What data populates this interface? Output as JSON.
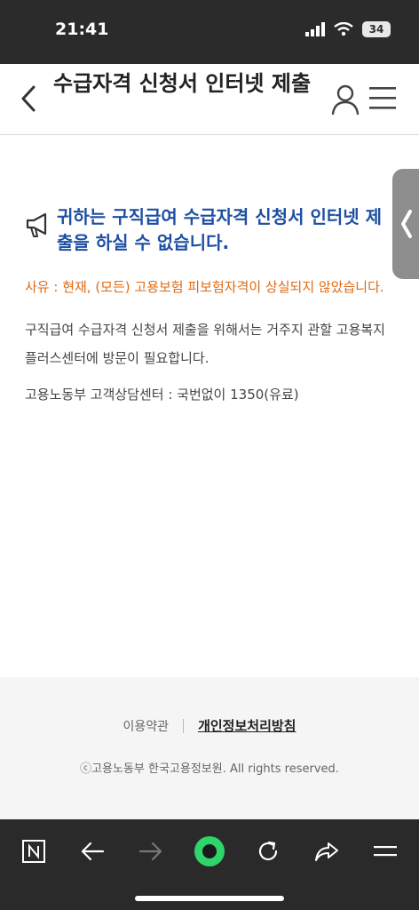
{
  "status": {
    "time": "21:41",
    "battery": "34"
  },
  "header": {
    "title": "수급자격 신청서 인터넷 제출"
  },
  "content": {
    "notice": "귀하는 구직급여 수급자격 신청서 인터넷 제출을 하실 수 없습니다.",
    "reason": "사유 : 현재, (모든) 고용보험 피보험자격이 상실되지 않았습니다.",
    "description": "구직급여 수급자격 신청서 제출을 위해서는 거주지 관할 고용복지플러스센터에 방문이 필요합니다.",
    "contact": "고용노동부 고객상담센터 : 국번없이 1350(유료)"
  },
  "footer": {
    "terms": "이용약관",
    "privacy": "개인정보처리방침",
    "copyright": "ⓒ고용노동부 한국고용정보원. All rights reserved."
  },
  "colors": {
    "notice": "#1e4fa3",
    "reason": "#e06a12",
    "statusbar": "#2b2b2b",
    "browser_ok": "#2fd46b"
  },
  "icons": [
    "back-icon",
    "user-icon",
    "menu-icon",
    "megaphone-icon",
    "naver-icon",
    "arrow-left-icon",
    "arrow-right-icon",
    "green-dot-icon",
    "refresh-icon",
    "share-icon",
    "hamburger-icon"
  ]
}
